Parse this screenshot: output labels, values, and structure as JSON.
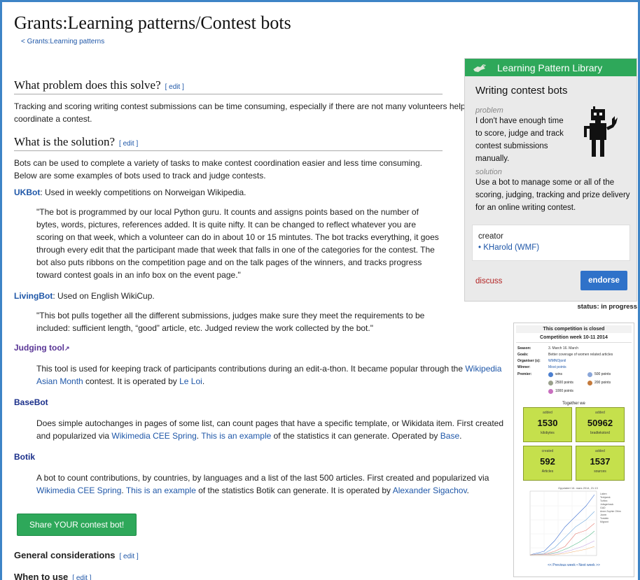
{
  "page": {
    "title": "Grants:Learning patterns/Contest bots",
    "breadcrumb": "< Grants:Learning patterns"
  },
  "sections": {
    "problem": {
      "heading": "What problem does this solve?",
      "edit": "[ edit ]",
      "text": "Tracking and scoring writing contest submissions can be time consuming, especially if there are not many volunteers helping coordinate a contest."
    },
    "solution": {
      "heading": "What is the solution?",
      "edit": "[ edit ]",
      "text": "Bots can be used to complete a variety of tasks to make contest coordination easier and less time consuming. Below are some examples of bots used to track and judge contests."
    },
    "general": {
      "heading": "General considerations",
      "edit": "[ edit ]"
    },
    "when": {
      "heading": "When to use",
      "edit": "[ edit ]"
    }
  },
  "bots": {
    "ukbot": {
      "name": "UKBot",
      "desc": ": Used in weekly competitions on Norweigan Wikipedia.",
      "quote": "\"The bot is programmed by our local Python guru. It counts and assigns points based on the number of bytes, words, pictures, references added. It is quite nifty. It can be changed to reflect whatever you are scoring on that week, which a volunteer can do in about 10 or 15 mintutes. The bot tracks everything, it goes through every edit that the participant made that week that falls in one of the categories for the contest. The bot also puts ribbons on the competition page and on the talk pages of the winners, and tracks progress toward contest goals in an info box on the event page.\""
    },
    "livingbot": {
      "name": "LivingBot",
      "desc": ": Used on English WikiCup.",
      "quote": "\"This bot pulls together all the different submissions, judges make sure they meet the requirements to be included: sufficient length, “good” article, etc. Judged review the work collected by the bot.\""
    },
    "judging": {
      "name": "Judging tool",
      "t1": "This tool is used for keeping track of participants contributions during an edit-a-thon. It became popular through the ",
      "l1": "Wikipedia Asian Month",
      "t2": " contest. It is operated by ",
      "l2": "Le Loi",
      "t3": "."
    },
    "basebot": {
      "name": "BaseBot",
      "t1": "Does simple autochanges in pages of some list, can count pages that have a specific template, or Wikidata item. First created and popularized via ",
      "l1": "Wikimedia CEE Spring",
      "t2": ". ",
      "l2": "This is an example",
      "t3": " of the statistics it can generate. Operated by ",
      "l3": "Base",
      "t4": "."
    },
    "botik": {
      "name": "Botik",
      "t1": "A bot to count contributions, by countries, by languages and a list of the last 500 articles. First created and popularized via ",
      "l1": "Wikimedia CEE Spring",
      "t2": ". ",
      "l2": "This is an example",
      "t3": " of the statistics Botik can generate. It is operated by ",
      "l3": "Alexander Sigachov",
      "t4": "."
    }
  },
  "share_button": "Share YOUR contest bot!",
  "library": {
    "header": "Learning Pattern Library",
    "title": "Writing contest bots",
    "problem_label": "problem",
    "problem": "I don't have enough time to score, judge and track contest submissions manually.",
    "solution_label": "solution",
    "solution": "Use a bot to manage some or all of the scoring, judging, tracking and prize delivery for an online writing contest.",
    "creator_label": "creator",
    "creator": "• KHarold (WMF)",
    "discuss": "discuss",
    "endorse": "endorse",
    "status": "status: in progress"
  },
  "competition": {
    "closed": "This competition is closed",
    "week": "Competition week 10-11 2014",
    "rows": [
      {
        "k": "Season:",
        "v": "3. March 16. March"
      },
      {
        "k": "Goals:",
        "v": "Better coverage of women related articles"
      },
      {
        "k": "Organiser (s):",
        "v": "WMNOjonil"
      },
      {
        "k": "Winner:",
        "v": "Most points"
      }
    ],
    "premier": "Premier:",
    "medals": [
      "wins",
      "500 points",
      "2500 points",
      "200 points",
      "1000 points"
    ],
    "together": "Together we",
    "tiles": [
      {
        "a": "added",
        "n": "1530",
        "u": "kilobytes"
      },
      {
        "a": "added",
        "n": "50962",
        "u": "bradtekstord"
      },
      {
        "a": "created",
        "n": "592",
        "u": "Articles"
      },
      {
        "a": "added",
        "n": "1537",
        "u": "sources"
      }
    ],
    "chart_caption": "Oppdatert 16. mars 2014, 21:13",
    "legend": [
      "Laken",
      "Terbjørnk",
      "Torfinn",
      "Jofagerback",
      "GAD",
      "Anne-Sophie Ofrim",
      "Jarvin",
      "Torstein",
      "Migrant"
    ],
    "nav": "<< Previous week • Next week >>"
  }
}
